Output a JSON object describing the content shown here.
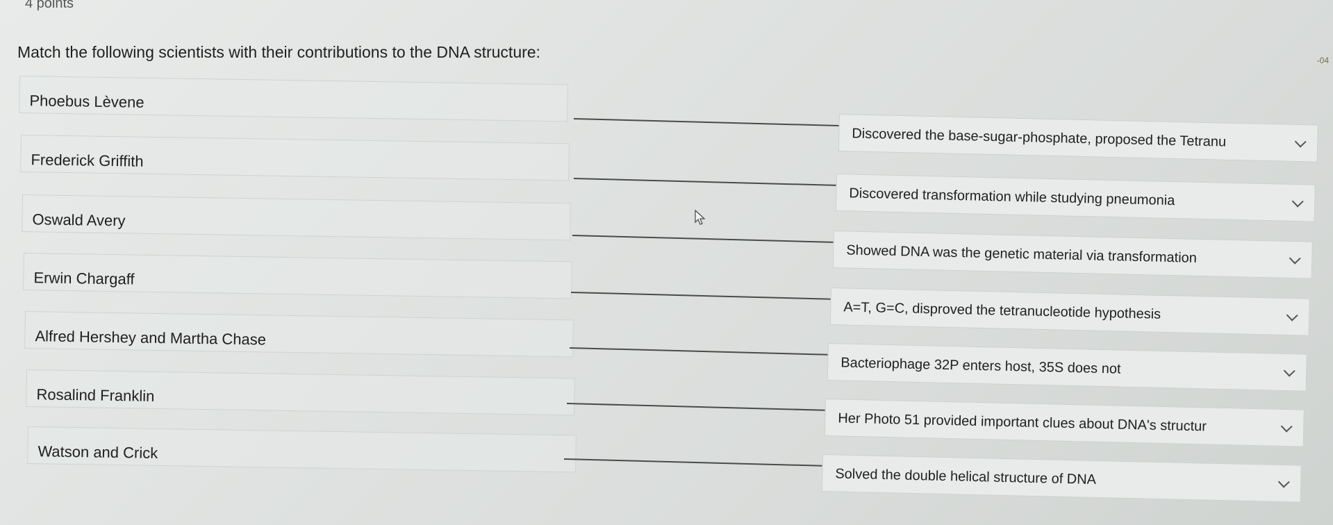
{
  "header": {
    "points": "4 points",
    "question": "Match the following scientists with their contributions to the DNA structure:",
    "edge_mark": "-04"
  },
  "pairs": [
    {
      "scientist": "Phoebus Lèvene",
      "answer": "Discovered the base-sugar-phosphate, proposed the Tetranu"
    },
    {
      "scientist": "Frederick Griffith",
      "answer": "Discovered transformation while studying pneumonia"
    },
    {
      "scientist": "Oswald Avery",
      "answer": "Showed DNA was the genetic material via transformation"
    },
    {
      "scientist": "Erwin Chargaff",
      "answer": "A=T, G=C, disproved the tetranucleotide hypothesis"
    },
    {
      "scientist": "Alfred Hershey and Martha Chase",
      "answer": "Bacteriophage 32P enters host, 35S does not"
    },
    {
      "scientist": "Rosalind Franklin",
      "answer": "Her Photo 51 provided important clues about DNA's structur"
    },
    {
      "scientist": "Watson and Crick",
      "answer": "Solved the double helical structure of DNA"
    }
  ],
  "icons": {
    "dropdown": "chevron-down-icon",
    "cursor": "mouse-cursor-icon"
  }
}
